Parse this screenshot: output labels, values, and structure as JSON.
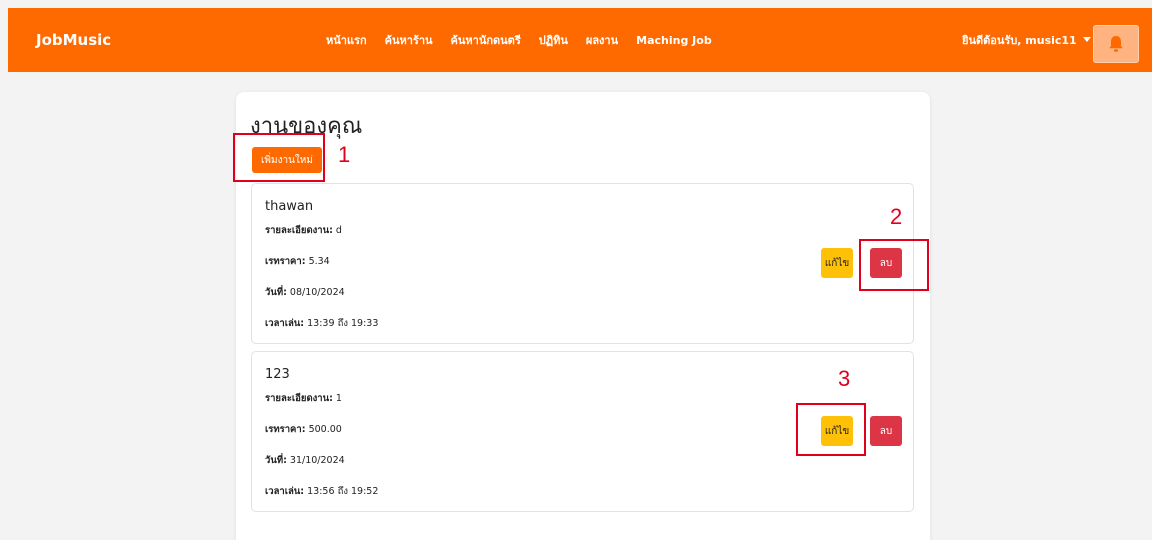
{
  "navbar": {
    "brand": "JobMusic",
    "links": [
      "หน้าแรก",
      "ค้นหาร้าน",
      "ค้นหานักดนตรี",
      "ปฏิทิน",
      "ผลงาน",
      "Maching Job"
    ],
    "user_greeting": "ยินดีต้อนรับ, music11",
    "bell_icon": "bell-icon",
    "color": "#ff6a00"
  },
  "main": {
    "title": "งานของคุณ",
    "add_button": "เพิ่มงานใหม่",
    "labels": {
      "details": "รายละเอียดงาน:",
      "rate": "เรทราคา:",
      "date": "วันที่:",
      "time": "เวลาเล่น:",
      "time_to": "ถึง"
    },
    "jobs": [
      {
        "title": "thawan",
        "details": "d",
        "rate": "5.34",
        "date": "08/10/2024",
        "start": "13:39",
        "end": "19:33",
        "edit_label": "แก้ไข",
        "delete_label": "ลบ"
      },
      {
        "title": "123",
        "details": "1",
        "rate": "500.00",
        "date": "31/10/2024",
        "start": "13:56",
        "end": "19:52",
        "edit_label": "แก้ไข",
        "delete_label": "ลบ"
      }
    ]
  },
  "annotations": {
    "one": "1",
    "two": "2",
    "three": "3",
    "color": "#e0001b"
  }
}
